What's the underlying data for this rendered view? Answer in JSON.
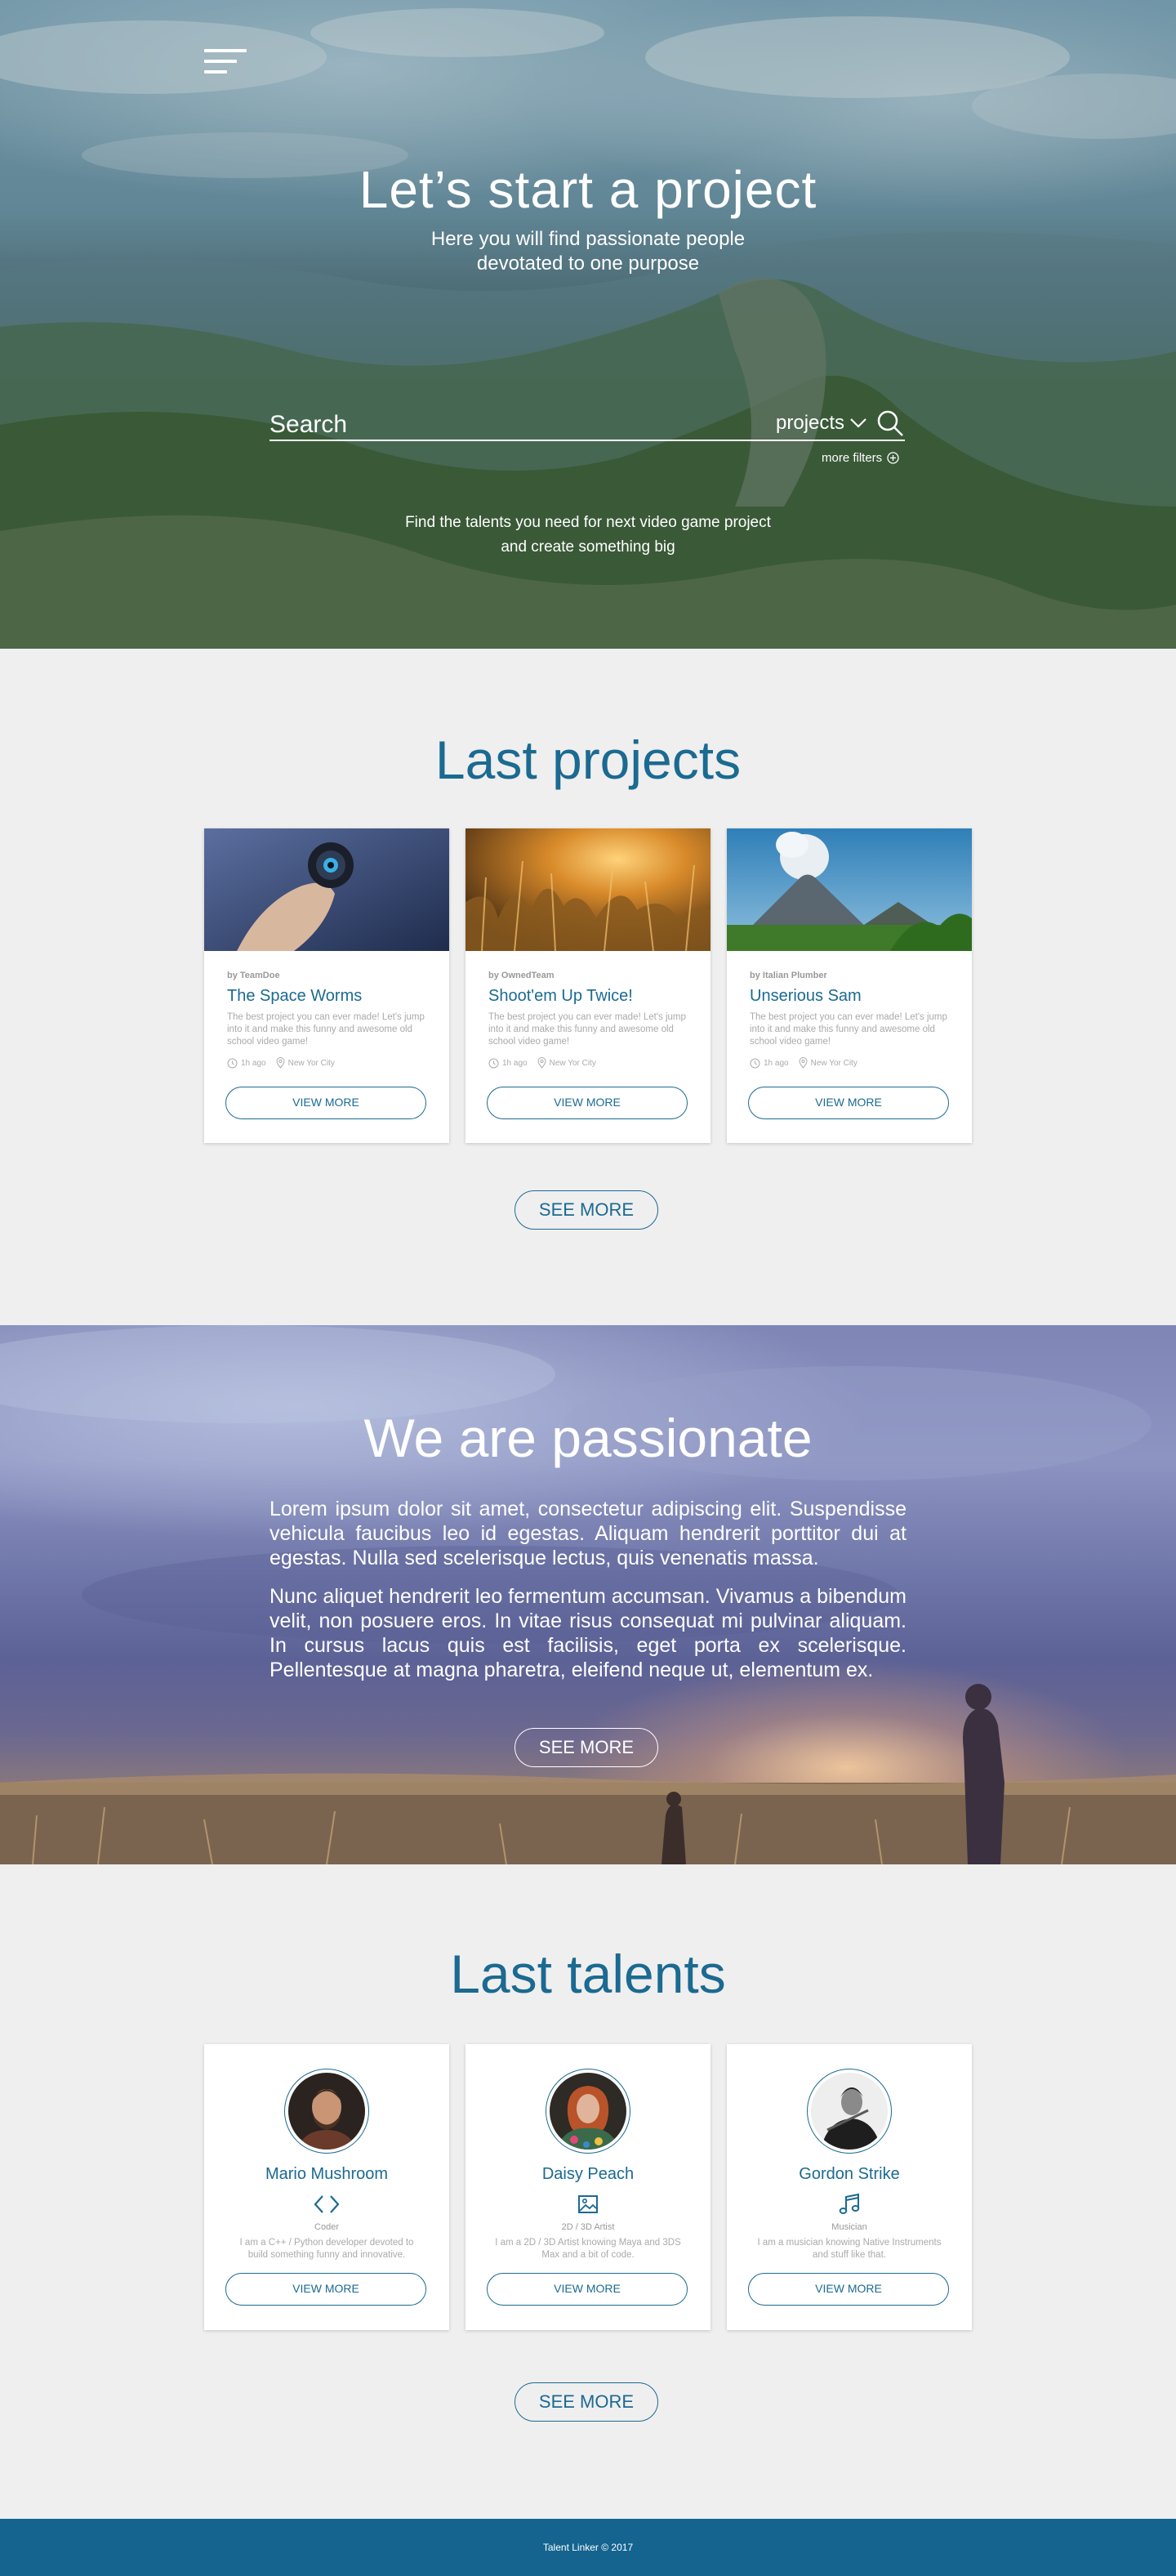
{
  "hero": {
    "title": "Let’s start a project",
    "subtitle_line1": "Here you will find passionate people",
    "subtitle_line2": "devotated to one purpose",
    "search_placeholder": "Search",
    "category": "projects",
    "more_filters": "more filters",
    "tagline_line1": "Find the talents you need for next video game project",
    "tagline_line2": "and create something big"
  },
  "projects": {
    "title": "Last projects",
    "items": [
      {
        "by": "by TeamDoe",
        "title": "The Space Worms",
        "desc": "The best project you can ever made! Let's jump into it and make this funny and awesome old school video game!",
        "time": "1h ago",
        "location": "New Yor City",
        "button": "VIEW MORE"
      },
      {
        "by": "by OwnedTeam",
        "title": "Shoot'em Up Twice!",
        "desc": "The best project you can ever made! Let's jump into it and make this funny and awesome old school video game!",
        "time": "1h ago",
        "location": "New Yor City",
        "button": "VIEW MORE"
      },
      {
        "by": "by Italian Plumber",
        "title": "Unserious Sam",
        "desc": "The best project you can ever made! Let's jump into it and make this funny and awesome old school video game!",
        "time": "1h ago",
        "location": "New Yor City",
        "button": "VIEW MORE"
      }
    ],
    "see_more": "SEE MORE"
  },
  "passion": {
    "title": "We are passionate",
    "para1": "Lorem ipsum dolor sit amet, consectetur adipiscing elit. Suspendisse vehicula faucibus leo id egestas. Aliquam hendrerit porttitor dui at egestas. Nulla sed scelerisque lectus, quis venenatis massa.",
    "para2": "Nunc aliquet hendrerit leo fermentum accumsan. Vivamus a bibendum velit, non posuere eros. In vitae risus consequat mi pulvinar aliquam. In cursus lacus quis est facilisis, eget porta ex scelerisque. Pellentesque at magna pharetra, eleifend neque ut, elementum ex.",
    "see_more": "SEE MORE"
  },
  "talents": {
    "title": "Last talents",
    "items": [
      {
        "name": "Mario Mushroom",
        "icon": "code-icon",
        "role": "Coder",
        "desc": "I am a C++ / Python developer devoted to build something funny and innovative.",
        "button": "VIEW MORE"
      },
      {
        "name": "Daisy Peach",
        "icon": "image-icon",
        "role": "2D / 3D Artist",
        "desc": "I am a 2D / 3D Artist knowing Maya and 3DS Max and a bit of code.",
        "button": "VIEW MORE"
      },
      {
        "name": "Gordon Strike",
        "icon": "music-note-icon",
        "role": "Musician",
        "desc": "I am a musician knowing Native Instruments and stuff like that.",
        "button": "VIEW MORE"
      }
    ],
    "see_more": "SEE MORE"
  },
  "footer": {
    "text": "Talent Linker © 2017"
  },
  "colors": {
    "accent": "#1b6a92",
    "footer_bg": "#14648f",
    "page_bg": "#efefef"
  }
}
